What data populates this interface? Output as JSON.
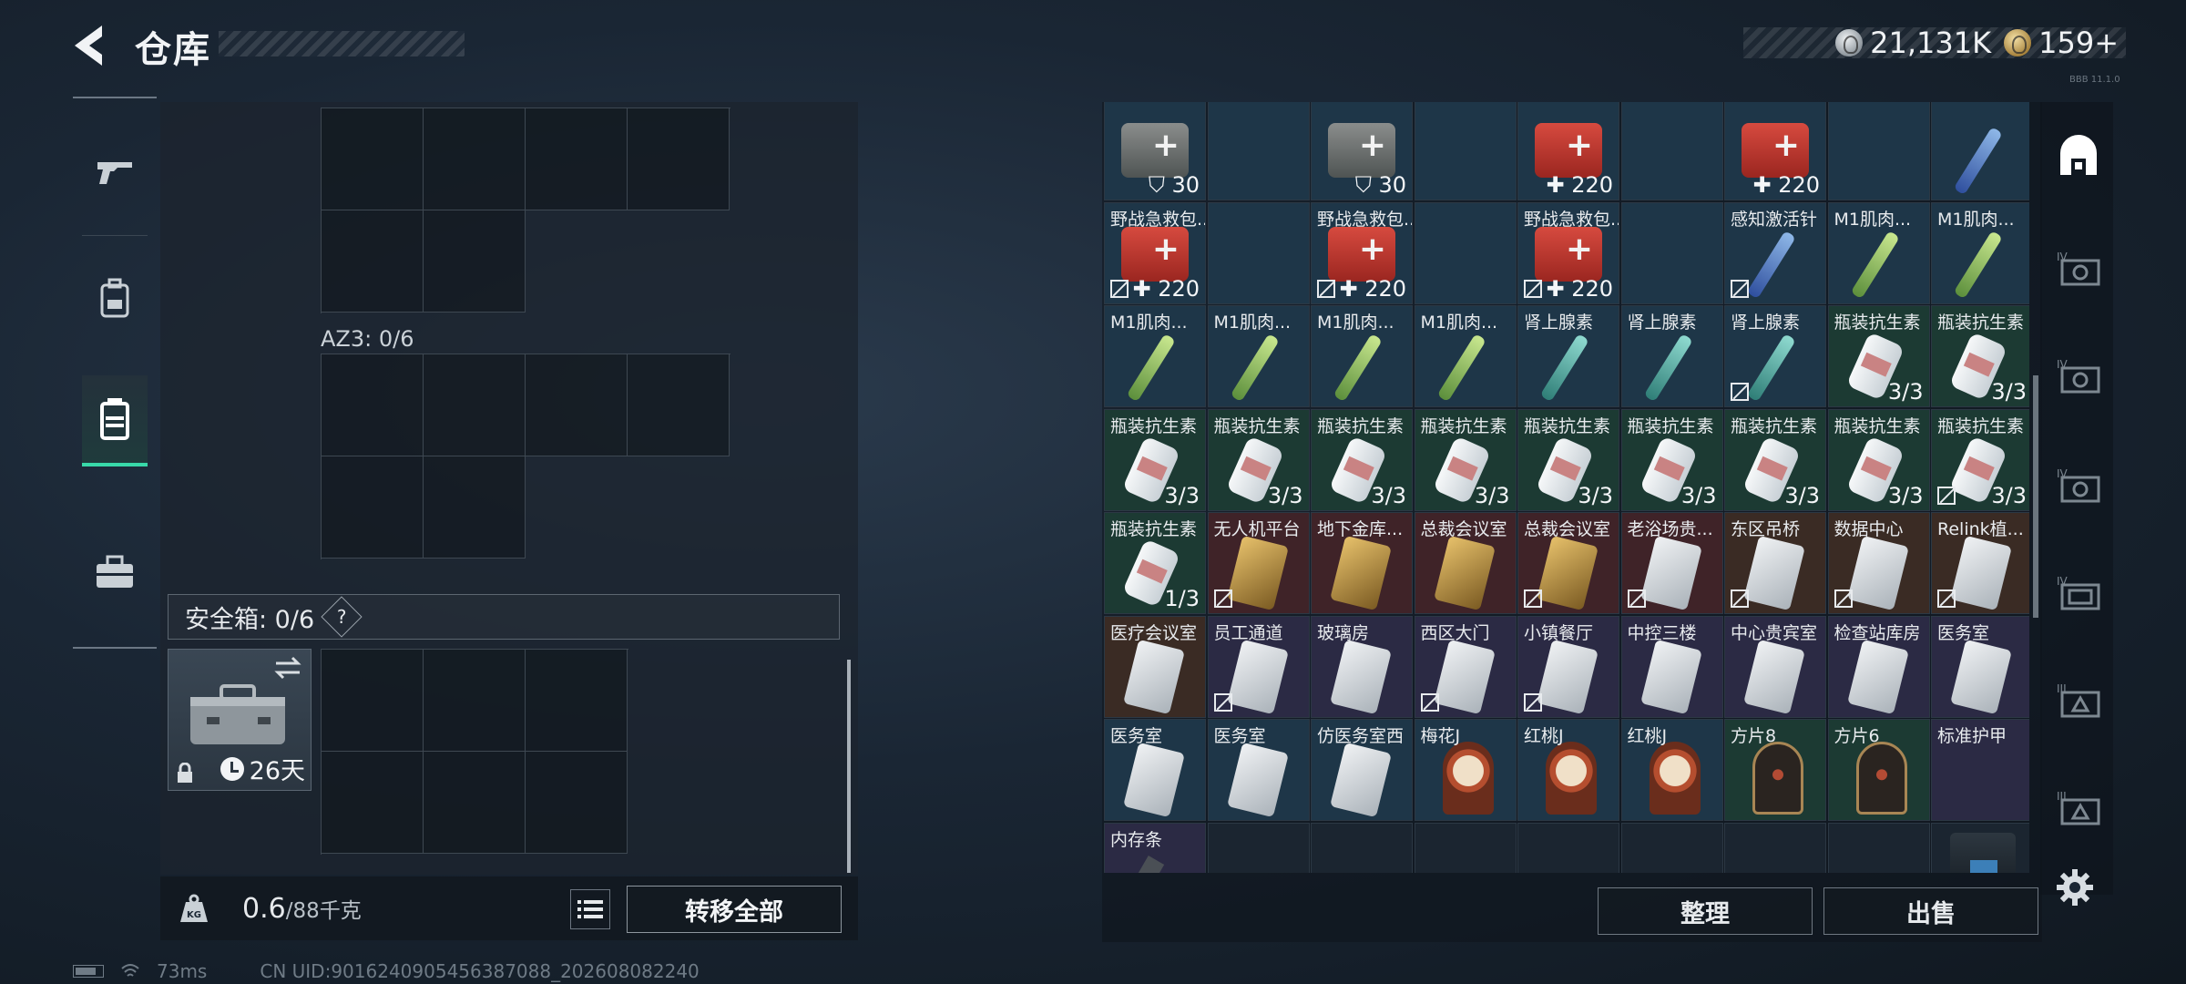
{
  "header": {
    "title": "仓库",
    "currencies": [
      {
        "icon": "silver-coin-icon",
        "value": "21,131K"
      },
      {
        "icon": "gold-coin-icon",
        "value": "159+"
      }
    ],
    "build_tag": "BBB 11.1.0"
  },
  "left_rail": [
    "gun-icon",
    "backpack-icon",
    "vest-icon",
    "toolbox-icon"
  ],
  "container": {
    "az3_label": "AZ3: 0/6",
    "safe_label": "安全箱: 0/6",
    "safe_help": "?",
    "safe_days": "26天"
  },
  "weight": {
    "kg_label": "KG",
    "current": "0.6",
    "max": "/88千克",
    "transfer_label": "转移全部"
  },
  "status": {
    "ping": "73ms",
    "uid": "CN UID:9016240905456387088_202608082240"
  },
  "inventory": {
    "rows": [
      [
        {
          "name": "",
          "qty": "30",
          "badge": "shield",
          "bg": "blue",
          "art": "medkit-grey"
        },
        {
          "name": "",
          "qty": "",
          "bg": "blue",
          "art": "none"
        },
        {
          "name": "",
          "qty": "30",
          "badge": "shield",
          "bg": "blue",
          "art": "medkit-grey"
        },
        {
          "name": "",
          "qty": "",
          "bg": "blue",
          "art": "none"
        },
        {
          "name": "",
          "qty": "220",
          "badge": "plus",
          "bg": "blue",
          "art": "medkit"
        },
        {
          "name": "",
          "qty": "",
          "bg": "blue",
          "art": "none"
        },
        {
          "name": "",
          "qty": "220",
          "badge": "plus",
          "bg": "blue",
          "art": "medkit"
        },
        {
          "name": "",
          "qty": "",
          "bg": "blue",
          "art": "none"
        },
        {
          "name": "",
          "qty": "",
          "bg": "blue",
          "art": "inj-blue"
        }
      ],
      [
        {
          "name": "野战急救包...",
          "qty": "220",
          "badge": "plus",
          "bg": "blue",
          "art": "medkit",
          "locked": true
        },
        {
          "name": "",
          "qty": "",
          "bg": "blue",
          "art": "none"
        },
        {
          "name": "野战急救包...",
          "qty": "220",
          "badge": "plus",
          "bg": "blue",
          "art": "medkit",
          "locked": true
        },
        {
          "name": "",
          "qty": "",
          "bg": "blue",
          "art": "none"
        },
        {
          "name": "野战急救包...",
          "qty": "220",
          "badge": "plus",
          "bg": "blue",
          "art": "medkit",
          "locked": true
        },
        {
          "name": "",
          "qty": "",
          "bg": "blue",
          "art": "none"
        },
        {
          "name": "感知激活针",
          "qty": "",
          "bg": "blue",
          "art": "inj-blue",
          "locked": true
        },
        {
          "name": "M1肌肉...",
          "qty": "",
          "bg": "blue",
          "art": "inj-green"
        },
        {
          "name": "M1肌肉...",
          "qty": "",
          "bg": "blue",
          "art": "inj-green"
        }
      ],
      [
        {
          "name": "M1肌肉...",
          "qty": "",
          "bg": "blue",
          "art": "inj-green"
        },
        {
          "name": "M1肌肉...",
          "qty": "",
          "bg": "blue",
          "art": "inj-green"
        },
        {
          "name": "M1肌肉...",
          "qty": "",
          "bg": "blue",
          "art": "inj-green"
        },
        {
          "name": "M1肌肉...",
          "qty": "",
          "bg": "blue",
          "art": "inj-green"
        },
        {
          "name": "肾上腺素",
          "qty": "",
          "bg": "blue",
          "art": "inj-teal"
        },
        {
          "name": "肾上腺素",
          "qty": "",
          "bg": "blue",
          "art": "inj-teal"
        },
        {
          "name": "肾上腺素",
          "qty": "",
          "bg": "blue",
          "art": "inj-teal",
          "locked": true
        },
        {
          "name": "瓶装抗生素",
          "qty": "3/3",
          "bg": "green",
          "art": "bottle"
        },
        {
          "name": "瓶装抗生素",
          "qty": "3/3",
          "bg": "green",
          "art": "bottle"
        }
      ],
      [
        {
          "name": "瓶装抗生素",
          "qty": "3/3",
          "bg": "green",
          "art": "bottle"
        },
        {
          "name": "瓶装抗生素",
          "qty": "3/3",
          "bg": "green",
          "art": "bottle"
        },
        {
          "name": "瓶装抗生素",
          "qty": "3/3",
          "bg": "green",
          "art": "bottle"
        },
        {
          "name": "瓶装抗生素",
          "qty": "3/3",
          "bg": "green",
          "art": "bottle"
        },
        {
          "name": "瓶装抗生素",
          "qty": "3/3",
          "bg": "green",
          "art": "bottle"
        },
        {
          "name": "瓶装抗生素",
          "qty": "3/3",
          "bg": "green",
          "art": "bottle"
        },
        {
          "name": "瓶装抗生素",
          "qty": "3/3",
          "bg": "green",
          "art": "bottle"
        },
        {
          "name": "瓶装抗生素",
          "qty": "3/3",
          "bg": "green",
          "art": "bottle"
        },
        {
          "name": "瓶装抗生素",
          "qty": "3/3",
          "bg": "green",
          "art": "bottle",
          "locked": true
        }
      ],
      [
        {
          "name": "瓶装抗生素",
          "qty": "1/3",
          "bg": "green",
          "art": "bottle"
        },
        {
          "name": "无人机平台",
          "qty": "",
          "bg": "red",
          "art": "card-gold",
          "locked": true
        },
        {
          "name": "地下金库...",
          "qty": "",
          "bg": "red",
          "art": "card-gold"
        },
        {
          "name": "总裁会议室",
          "qty": "",
          "bg": "red",
          "art": "card-gold"
        },
        {
          "name": "总裁会议室",
          "qty": "",
          "bg": "red",
          "art": "card-gold",
          "locked": true
        },
        {
          "name": "老浴场贵...",
          "qty": "",
          "bg": "red",
          "art": "card",
          "locked": true
        },
        {
          "name": "东区吊桥",
          "qty": "",
          "bg": "brown",
          "art": "card",
          "locked": true
        },
        {
          "name": "数据中心",
          "qty": "",
          "bg": "brown",
          "art": "card",
          "locked": true
        },
        {
          "name": "Relink植...",
          "qty": "",
          "bg": "brown",
          "art": "card",
          "locked": true
        }
      ],
      [
        {
          "name": "医疗会议室",
          "qty": "",
          "bg": "brown",
          "art": "card"
        },
        {
          "name": "员工通道",
          "qty": "",
          "bg": "purple",
          "art": "card",
          "locked": true
        },
        {
          "name": "玻璃房",
          "qty": "",
          "bg": "purple",
          "art": "card"
        },
        {
          "name": "西区大门",
          "qty": "",
          "bg": "purple",
          "art": "card",
          "locked": true
        },
        {
          "name": "小镇餐厅",
          "qty": "",
          "bg": "purple",
          "art": "card",
          "locked": true
        },
        {
          "name": "中控三楼",
          "qty": "",
          "bg": "purple",
          "art": "card"
        },
        {
          "name": "中心贵宾室",
          "qty": "",
          "bg": "purple",
          "art": "card"
        },
        {
          "name": "检查站库房",
          "qty": "",
          "bg": "purple",
          "art": "card"
        },
        {
          "name": "医务室",
          "qty": "",
          "bg": "purple",
          "art": "card"
        }
      ],
      [
        {
          "name": "医务室",
          "qty": "",
          "bg": "blue",
          "art": "card"
        },
        {
          "name": "医务室",
          "qty": "",
          "bg": "blue",
          "art": "card"
        },
        {
          "name": "仿医务室西",
          "qty": "",
          "bg": "blue",
          "art": "card"
        },
        {
          "name": "梅花J",
          "qty": "",
          "bg": "blue",
          "art": "plaque"
        },
        {
          "name": "红桃J",
          "qty": "",
          "bg": "blue",
          "art": "plaque"
        },
        {
          "name": "红桃J",
          "qty": "",
          "bg": "blue",
          "art": "plaque"
        },
        {
          "name": "方片8",
          "qty": "",
          "bg": "green",
          "art": "plaque-dark"
        },
        {
          "name": "方片6",
          "qty": "",
          "bg": "green",
          "art": "plaque-dark"
        },
        {
          "name": "标准护甲",
          "qty": "",
          "bg": "purple",
          "art": "none"
        }
      ],
      [
        {
          "name": "内存条",
          "qty": "",
          "bg": "purple",
          "art": "mem"
        },
        {
          "name": "",
          "qty": "",
          "bg": "dark",
          "art": "none"
        },
        {
          "name": "",
          "qty": "",
          "bg": "dark",
          "art": "none"
        },
        {
          "name": "",
          "qty": "",
          "bg": "dark",
          "art": "none"
        },
        {
          "name": "",
          "qty": "",
          "bg": "dark",
          "art": "none"
        },
        {
          "name": "",
          "qty": "",
          "bg": "dark",
          "art": "none"
        },
        {
          "name": "",
          "qty": "",
          "bg": "dark",
          "art": "none"
        },
        {
          "name": "",
          "qty": "",
          "bg": "dark",
          "art": "none"
        },
        {
          "name": "",
          "qty": "",
          "bg": "dark",
          "art": "armor"
        }
      ]
    ],
    "tidy_label": "整理",
    "sell_label": "出售"
  },
  "right_rail": [
    "all-items-icon",
    "armor-level-4-icon",
    "armor-level-4-icon",
    "armor-level-4-icon",
    "armor-level-4-icon",
    "armor-level-3-icon",
    "armor-level-3-icon"
  ],
  "colors": {
    "accent_green": "#38d9a9",
    "panel_bg": "#1c242e"
  }
}
